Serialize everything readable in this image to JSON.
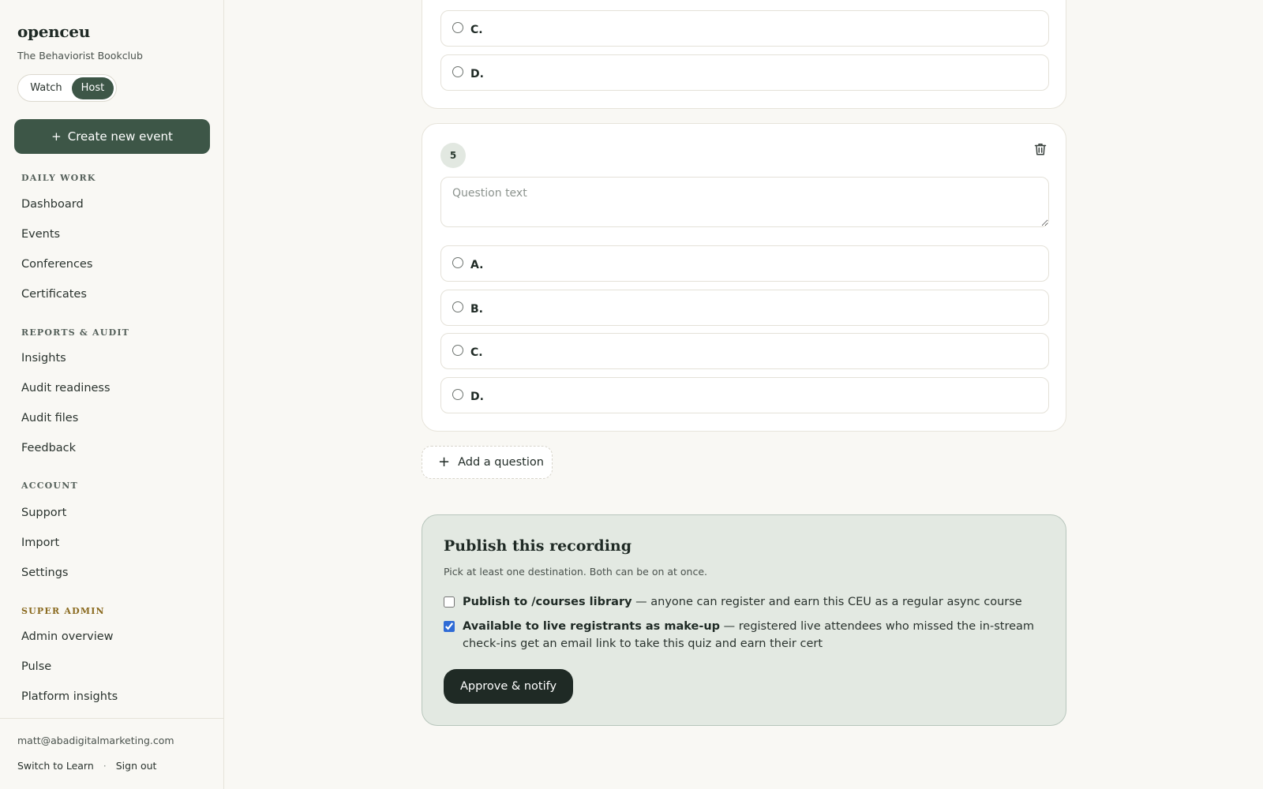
{
  "brand": "openceu",
  "org_name": "The Behaviorist Bookclub",
  "mode_toggle": {
    "watch": "Watch",
    "host": "Host",
    "selected": "Host"
  },
  "create_button": {
    "icon": "+",
    "label": "Create new event"
  },
  "nav": {
    "daily_work": {
      "label": "DAILY WORK",
      "items": [
        "Dashboard",
        "Events",
        "Conferences",
        "Certificates"
      ]
    },
    "reports_audit": {
      "label": "REPORTS & AUDIT",
      "items": [
        "Insights",
        "Audit readiness",
        "Audit files",
        "Feedback"
      ]
    },
    "account": {
      "label": "ACCOUNT",
      "items": [
        "Support",
        "Import",
        "Settings"
      ]
    },
    "super_admin": {
      "label": "SUPER ADMIN",
      "items": [
        "Admin overview",
        "Pulse",
        "Platform insights"
      ]
    }
  },
  "footer": {
    "email": "matt@abadigitalmarketing.com",
    "switch_label": "Switch to Learn",
    "separator": "·",
    "signout_label": "Sign out"
  },
  "prev_question": {
    "options": [
      "C.",
      "D."
    ]
  },
  "question5": {
    "number": "5",
    "text_placeholder": "Question text",
    "text_value": "",
    "options": [
      "A.",
      "B.",
      "C.",
      "D."
    ],
    "delete_icon": "trash-icon"
  },
  "add_question": {
    "icon": "+",
    "label": "Add a question"
  },
  "publish": {
    "title": "Publish this recording",
    "subtitle": "Pick at least one destination. Both can be on at once.",
    "courses": {
      "checked": false,
      "bold": "Publish to /courses library",
      "rest": " — anyone can register and earn this CEU as a regular async course"
    },
    "makeup": {
      "checked": true,
      "bold": "Available to live registrants as make-up",
      "rest": " — registered live attendees who missed the in-stream check-ins get an email link to take this quiz and earn their cert"
    },
    "approve_label": "Approve & notify"
  },
  "colors": {
    "accent_green": "#3d5647",
    "publish_bg": "#e3e9e2",
    "approve_bg": "#1f2a25",
    "super_admin_label": "#8a6a1f"
  }
}
